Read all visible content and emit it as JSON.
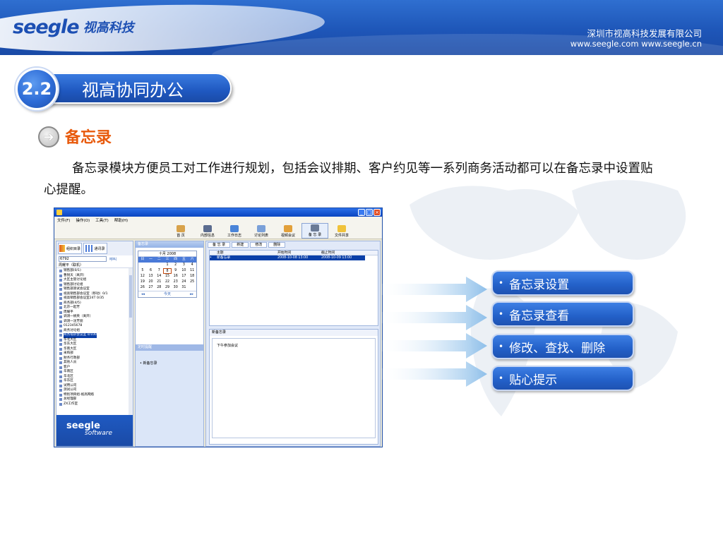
{
  "header": {
    "logo_latin": "seegle",
    "logo_cn": "视高科技",
    "company_name": "深圳市视高科技发展有限公司",
    "company_urls": "www.seegle.com  www.seegle.cn"
  },
  "section": {
    "number": "2.2",
    "title": "视高协同办公"
  },
  "memo": {
    "heading": "备忘录",
    "description": "备忘录模块方便员工对工作进行规划，包括会议排期、客户约见等一系列商务活动都可以在备忘录中设置贴心提醒。"
  },
  "bullets": [
    "备忘录设置",
    "备忘录查看",
    "修改、查找、删除",
    "贴心提示"
  ],
  "app": {
    "menu": [
      "文件(F)",
      "操作(O)",
      "工具(T)",
      "帮助(H)"
    ],
    "toolbar": [
      "首 页",
      "内部信息",
      "工作日志",
      "讨论列表",
      "视频会议",
      "备 忘 录",
      "文件共享"
    ],
    "left_tabs": [
      "组织目录",
      "通讯录"
    ],
    "search_value": "6792",
    "call_label": "呼叫",
    "user_label": "周耀平（联机）",
    "tree": [
      "销售部(0/1)",
      "曹锐天（离开）",
      "大区主管讨论组",
      "销售部讨论组",
      "销售部测试会议室",
      "视高销售部会议室（移动）0/1",
      "视高销售部会议室24T 0/35",
      "商务部(4/5)",
      "北京一起芳",
      "周耀平",
      "调测一姚英（离开）",
      "调测一沈芳丽",
      "012345678",
      "商务讨论组",
      "商务培训会议室 0/100",
      "华北大区",
      "华东大区",
      "华南大区",
      "采购部",
      "财务行政部",
      "其他人员",
      "客户",
      "华南区",
      "华北区",
      "华东区",
      "试用公司",
      "测试公司",
      "特别项目组-视高网络",
      "总经理部",
      "ZX工作室"
    ],
    "tree_selected": 14,
    "logo_l1": "seegle",
    "logo_l2": "software",
    "mid_head": "备忘录",
    "calendar": {
      "title": "十月 2008",
      "dow": [
        "日",
        "一",
        "二",
        "三",
        "四",
        "五",
        "六"
      ],
      "days": [
        "",
        "",
        "",
        "1",
        "2",
        "3",
        "4",
        "5",
        "6",
        "7",
        "8",
        "9",
        "10",
        "11",
        "12",
        "13",
        "14",
        "15",
        "16",
        "17",
        "18",
        "19",
        "20",
        "21",
        "22",
        "23",
        "24",
        "25",
        "26",
        "27",
        "28",
        "29",
        "30",
        "31",
        ""
      ],
      "today_label": "今天"
    },
    "reminder_head": "定时提醒",
    "reminder_item": "新备忘录",
    "right_tabs": [
      "备 忘 录",
      "新建",
      "修改",
      "删除"
    ],
    "table_headers": [
      "主题",
      "开始时间",
      "截止时间"
    ],
    "table_rows": [
      [
        "新备忘录",
        "2008-10-08 13:00",
        "2008-10-09 13:00"
      ]
    ],
    "detail_head": "新备忘录",
    "detail_content": "下午参加会议"
  },
  "colors": {
    "brand_blue": "#1e56b8",
    "heading_orange": "#e85a0c",
    "bullet_blue": "#2360c8"
  }
}
